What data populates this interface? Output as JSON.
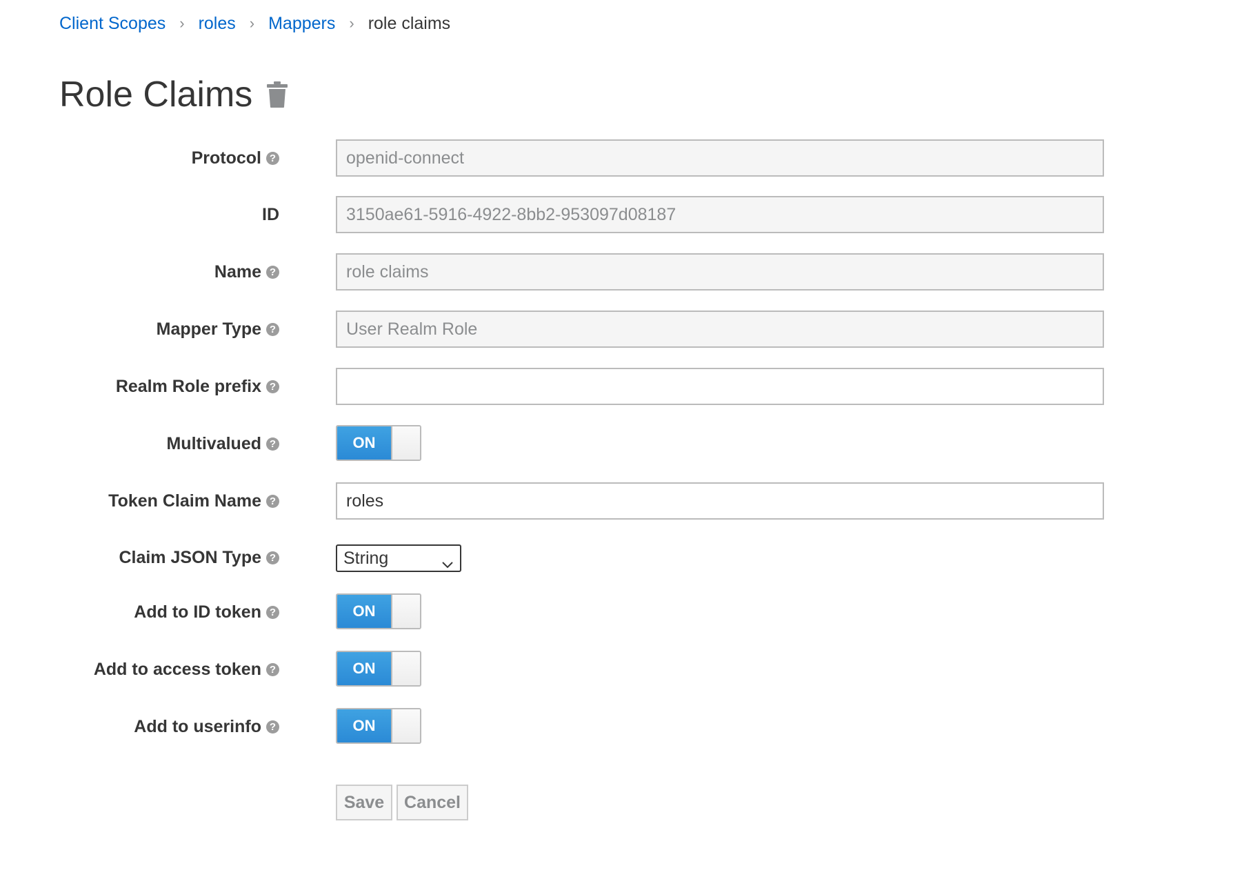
{
  "breadcrumb": {
    "items": [
      {
        "label": "Client Scopes"
      },
      {
        "label": "roles"
      },
      {
        "label": "Mappers"
      }
    ],
    "separator": "›",
    "current": "role claims"
  },
  "header": {
    "title": "Role Claims",
    "delete_icon": "trash-icon"
  },
  "form": {
    "protocol": {
      "label": "Protocol",
      "value": "openid-connect"
    },
    "id": {
      "label": "ID",
      "value": "3150ae61-5916-4922-8bb2-953097d08187"
    },
    "name": {
      "label": "Name",
      "value": "role claims"
    },
    "mapper_type": {
      "label": "Mapper Type",
      "value": "User Realm Role"
    },
    "realm_role_prefix": {
      "label": "Realm Role prefix",
      "value": ""
    },
    "multivalued": {
      "label": "Multivalued",
      "state": "ON"
    },
    "token_claim_name": {
      "label": "Token Claim Name",
      "value": "roles"
    },
    "claim_json_type": {
      "label": "Claim JSON Type",
      "selected": "String"
    },
    "add_to_id_token": {
      "label": "Add to ID token",
      "state": "ON"
    },
    "add_to_access_token": {
      "label": "Add to access token",
      "state": "ON"
    },
    "add_to_userinfo": {
      "label": "Add to userinfo",
      "state": "ON"
    },
    "help_glyph": "?"
  },
  "actions": {
    "save_label": "Save",
    "cancel_label": "Cancel"
  },
  "colors": {
    "link": "#0066cc",
    "toggle_on": "#2b8ad6",
    "readonly_bg": "#f5f5f5"
  }
}
